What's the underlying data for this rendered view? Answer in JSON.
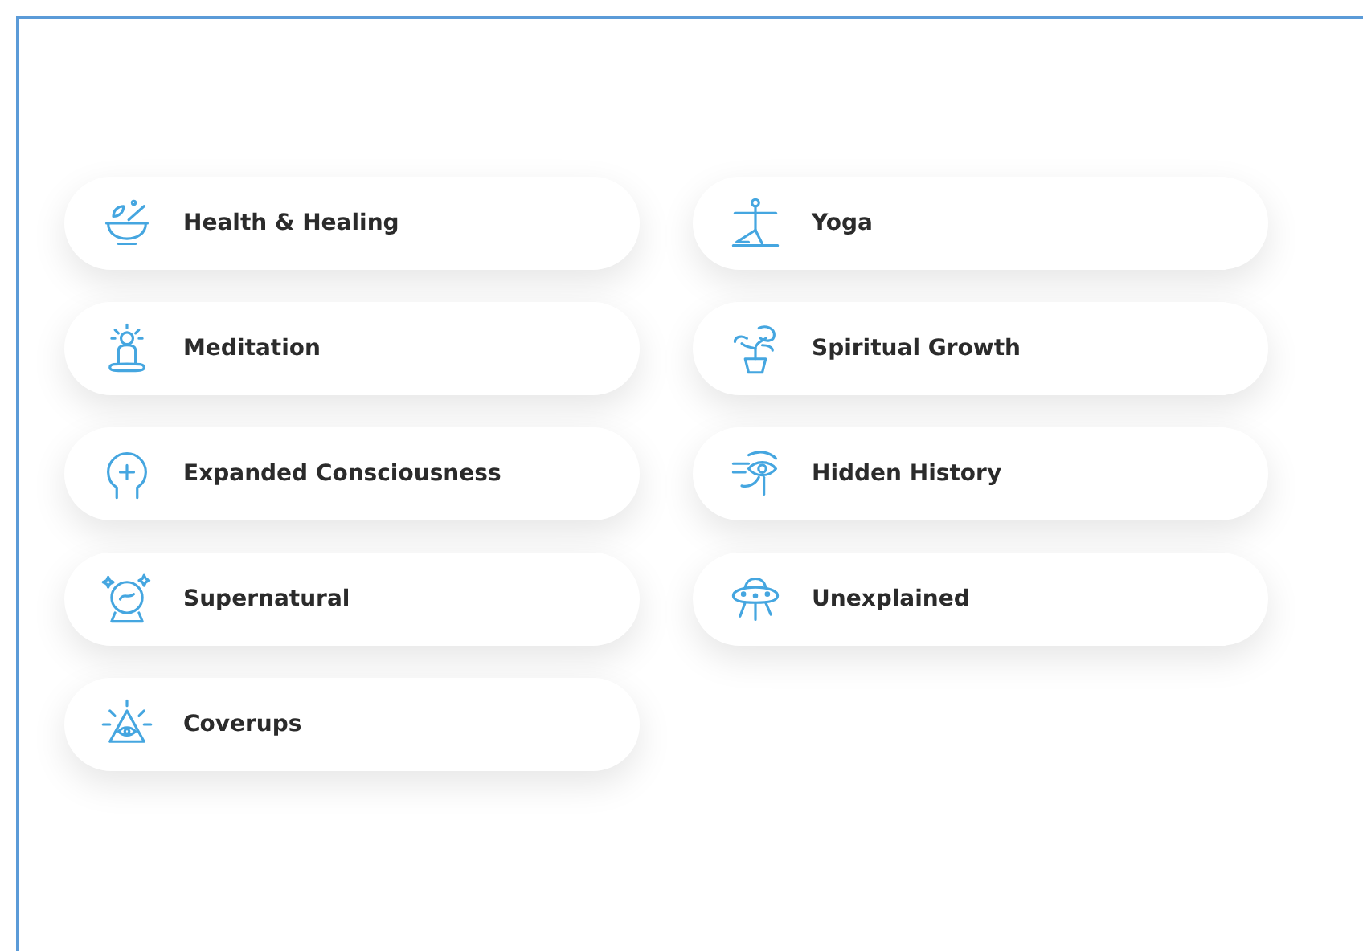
{
  "columns": [
    {
      "items": [
        {
          "label": "Health & Healing"
        },
        {
          "label": "Meditation"
        },
        {
          "label": "Expanded Consciousness"
        },
        {
          "label": "Supernatural"
        },
        {
          "label": "Coverups"
        }
      ]
    },
    {
      "items": [
        {
          "label": "Yoga"
        },
        {
          "label": "Spiritual Growth"
        },
        {
          "label": "Hidden History"
        },
        {
          "label": "Unexplained"
        }
      ]
    }
  ]
}
